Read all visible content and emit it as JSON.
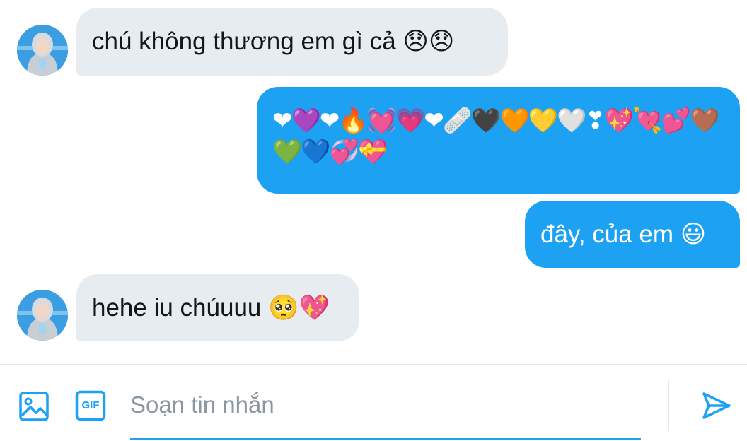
{
  "conversation": {
    "messages": [
      {
        "direction": "incoming",
        "text": "chú không thương em gì cả 😞😞"
      },
      {
        "direction": "outgoing",
        "text": "❤💜❤🔥💓💗❤🩹🖤🧡💛🤍❣💖💘💕🤎💚💙💞💝"
      },
      {
        "direction": "outgoing",
        "text": "đây, của em 😃"
      },
      {
        "direction": "incoming",
        "text": "hehe iu chúuuu 🥺💖"
      }
    ]
  },
  "composer": {
    "placeholder": "Soạn tin nhắn",
    "gif_label": "GIF",
    "media_icon": "image-icon",
    "send_icon": "send-icon"
  },
  "colors": {
    "incoming_bubble": "#e6ecf0",
    "outgoing_bubble": "#1da1f2",
    "accent": "#1da1f2",
    "placeholder": "#8a97a3"
  }
}
